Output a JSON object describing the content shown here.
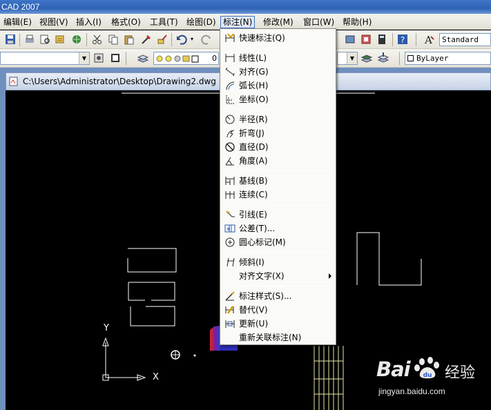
{
  "window": {
    "title": "CAD 2007"
  },
  "menubar": {
    "items": [
      {
        "label": "编辑(E)"
      },
      {
        "label": "视图(V)"
      },
      {
        "label": "插入(I)"
      },
      {
        "label": "格式(O)"
      },
      {
        "label": "工具(T)"
      },
      {
        "label": "绘图(D)"
      },
      {
        "label": "标注(N)"
      },
      {
        "label": "修改(M)"
      },
      {
        "label": "窗口(W)"
      },
      {
        "label": "帮助(H)"
      }
    ],
    "active_index": 6
  },
  "toolbar": {
    "text_style": "Standard",
    "layer_value": "0",
    "color_value": "ByLayer"
  },
  "document": {
    "title": "C:\\Users\\Administrator\\Desktop\\Drawing2.dwg"
  },
  "dimension_menu": {
    "items": [
      {
        "label": "快速标注(Q)",
        "icon": "quick-dimension-icon"
      },
      {
        "label": "线性(L)",
        "icon": "linear-dimension-icon"
      },
      {
        "label": "对齐(G)",
        "icon": "aligned-dimension-icon"
      },
      {
        "label": "弧长(H)",
        "icon": "arc-length-icon"
      },
      {
        "label": "坐标(O)",
        "icon": "ordinate-icon"
      },
      {
        "label": "半径(R)",
        "icon": "radius-icon"
      },
      {
        "label": "折弯(J)",
        "icon": "jogged-icon"
      },
      {
        "label": "直径(D)",
        "icon": "diameter-icon"
      },
      {
        "label": "角度(A)",
        "icon": "angular-icon"
      },
      {
        "label": "基线(B)",
        "icon": "baseline-icon"
      },
      {
        "label": "连续(C)",
        "icon": "continue-icon"
      },
      {
        "label": "引线(E)",
        "icon": "leader-icon"
      },
      {
        "label": "公差(T)...",
        "icon": "tolerance-icon"
      },
      {
        "label": "圆心标记(M)",
        "icon": "center-mark-icon"
      },
      {
        "label": "倾斜(I)",
        "icon": "oblique-icon"
      },
      {
        "label": "对齐文字(X)",
        "icon": ""
      },
      {
        "label": "标注样式(S)...",
        "icon": "dimension-style-icon"
      },
      {
        "label": "替代(V)",
        "icon": "override-icon"
      },
      {
        "label": "更新(U)",
        "icon": "update-icon"
      },
      {
        "label": "重新关联标注(N)",
        "icon": ""
      }
    ]
  },
  "ucs": {
    "x_label": "X",
    "y_label": "Y"
  },
  "watermark": {
    "brand": "Bai",
    "brand_cn": "经验",
    "url": "jingyan.baidu.com"
  },
  "colors": {
    "canvas_bg": "#000000",
    "drawing_lines": "#ffffff",
    "menu_bg": "#fafaf6",
    "active_menu_border": "#3f6fbf"
  }
}
